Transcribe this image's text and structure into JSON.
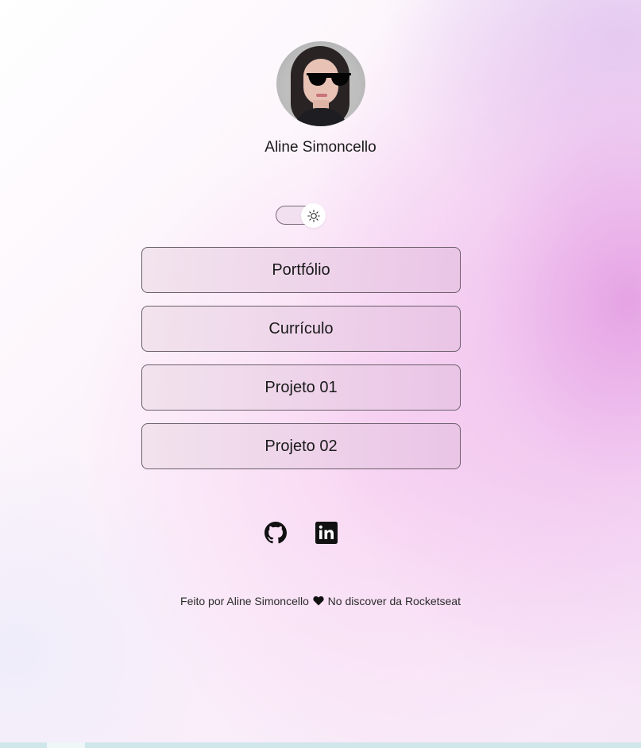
{
  "profile": {
    "name": "Aline Simoncello",
    "avatar_alt": "Aline Simoncello"
  },
  "theme_toggle": {
    "icon": "sun-icon",
    "state": "light"
  },
  "links": [
    {
      "label": "Portfólio"
    },
    {
      "label": "Currículo"
    },
    {
      "label": "Projeto 01"
    },
    {
      "label": "Projeto 02"
    }
  ],
  "social": {
    "github_icon": "github-icon",
    "linkedin_icon": "linkedin-icon"
  },
  "footer": {
    "prefix": "Feito por Aline Simoncello",
    "heart_icon": "heart-icon",
    "suffix": "No discover da Rocketseat"
  },
  "colors": {
    "accent_pink": "#e296e1",
    "button_border": "#6b5f6a",
    "text": "#1a1a1a"
  }
}
